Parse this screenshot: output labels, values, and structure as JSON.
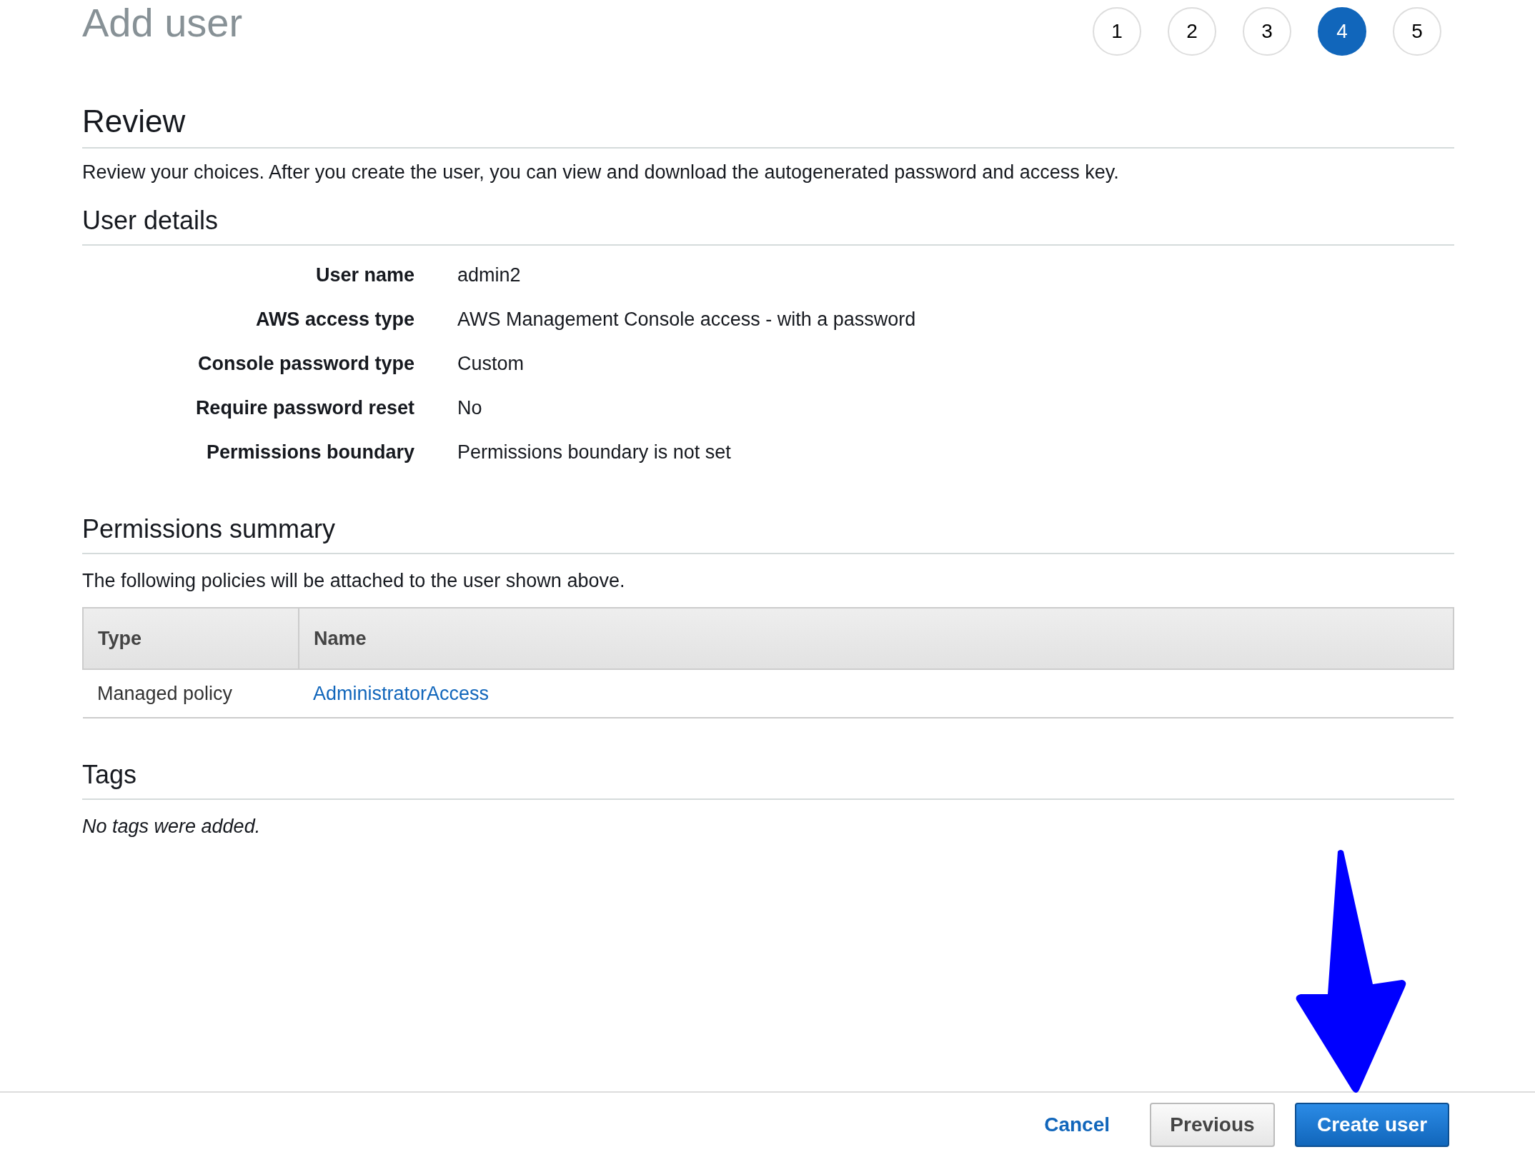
{
  "page": {
    "title": "Add user"
  },
  "steps": [
    {
      "label": "1",
      "selected": false
    },
    {
      "label": "2",
      "selected": false
    },
    {
      "label": "3",
      "selected": false
    },
    {
      "label": "4",
      "selected": true
    },
    {
      "label": "5",
      "selected": false
    }
  ],
  "review": {
    "heading": "Review",
    "description": "Review your choices. After you create the user, you can view and download the autogenerated password and access key."
  },
  "user_details": {
    "heading": "User details",
    "rows": [
      {
        "label": "User name",
        "value": "admin2"
      },
      {
        "label": "AWS access type",
        "value": "AWS Management Console access - with a password"
      },
      {
        "label": "Console password type",
        "value": "Custom"
      },
      {
        "label": "Require password reset",
        "value": "No"
      },
      {
        "label": "Permissions boundary",
        "value": "Permissions boundary is not set"
      }
    ]
  },
  "permissions_summary": {
    "heading": "Permissions summary",
    "description": "The following policies will be attached to the user shown above.",
    "table": {
      "columns": [
        "Type",
        "Name"
      ],
      "rows": [
        {
          "type": "Managed policy",
          "name": "AdministratorAccess"
        }
      ]
    }
  },
  "tags": {
    "heading": "Tags",
    "empty_text": "No tags were added."
  },
  "annotations": [
    {
      "kind": "arrow"
    }
  ],
  "footer": {
    "buttons": [
      {
        "label": "Cancel",
        "kind": "link"
      },
      {
        "label": "Previous",
        "kind": "secondary"
      },
      {
        "label": "Create user",
        "kind": "primary"
      }
    ]
  }
}
